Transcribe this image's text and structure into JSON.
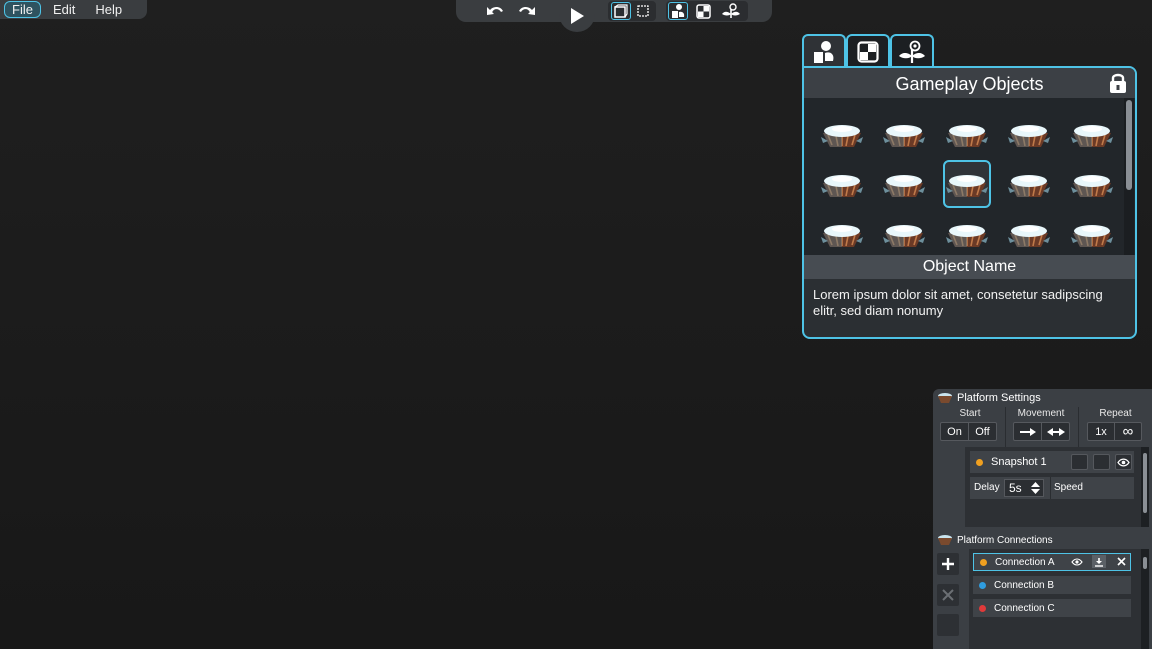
{
  "menu": {
    "items": [
      "File",
      "Edit",
      "Help"
    ],
    "active": "File"
  },
  "toolbar": {
    "undo_icon": "undo-icon",
    "redo_icon": "redo-icon",
    "play_icon": "play-icon",
    "view_modes": [
      "view-3d-icon",
      "view-2d-icon"
    ],
    "panel_modes": [
      "gameplay-icon",
      "checker-icon",
      "plant-icon"
    ]
  },
  "objects_panel": {
    "tabs": [
      "gameplay-objects-tab",
      "checker-tab",
      "decoration-tab"
    ],
    "title": "Gameplay Objects",
    "object_name": "Object Name",
    "description": "Lorem ipsum dolor sit amet, consetetur sadipscing elitr, sed diam nonumy",
    "selected_index": 7,
    "item_count": 15
  },
  "platform_settings": {
    "title": "Platform Settings",
    "start": {
      "label": "Start",
      "options": [
        "On",
        "Off"
      ]
    },
    "movement": {
      "label": "Movement"
    },
    "repeat": {
      "label": "Repeat",
      "options": [
        "1x",
        "∞"
      ]
    },
    "snapshot": {
      "name": "Snapshot 1",
      "dot_color": "#f0a020"
    },
    "delay": {
      "label": "Delay",
      "value": "5s"
    },
    "speed": {
      "label": "Speed"
    }
  },
  "platform_connections": {
    "title": "Platform Connections",
    "items": [
      {
        "name": "Connection A",
        "color": "#f0a020"
      },
      {
        "name": "Connection B",
        "color": "#2f9de0"
      },
      {
        "name": "Connection C",
        "color": "#e03a3a"
      }
    ]
  },
  "colors": {
    "accent": "#4ec3e6",
    "panel": "#3b3f44",
    "background": "#1c1c1c"
  }
}
